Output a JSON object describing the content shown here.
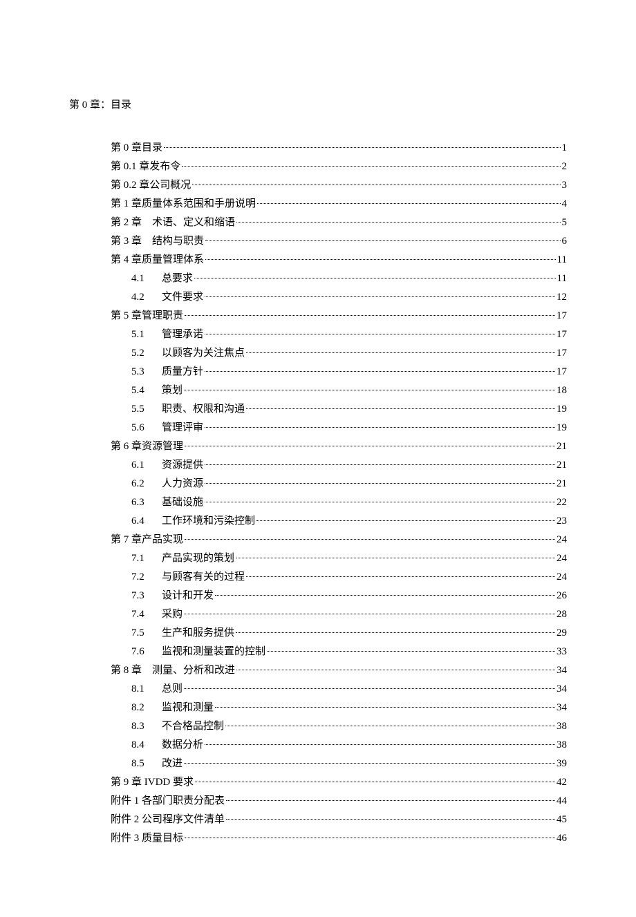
{
  "title": "第 0 章：目录",
  "toc": [
    {
      "level": 1,
      "num": "",
      "label": "第 0 章目录",
      "page": "1"
    },
    {
      "level": 1,
      "num": "",
      "label": "第 0.1 章发布令",
      "page": "2"
    },
    {
      "level": 1,
      "num": "",
      "label": "第 0.2 章公司概况",
      "page": "3"
    },
    {
      "level": 1,
      "num": "",
      "label": "第 1 章质量体系范围和手册说明",
      "page": "4"
    },
    {
      "level": 1,
      "num": "",
      "label": "第 2 章　术语、定义和缩语",
      "page": "5"
    },
    {
      "level": 1,
      "num": "",
      "label": "第 3 章　结构与职责",
      "page": "6"
    },
    {
      "level": 1,
      "num": "",
      "label": "第 4 章质量管理体系",
      "page": "11"
    },
    {
      "level": 2,
      "num": "4.1",
      "label": "总要求",
      "page": "11"
    },
    {
      "level": 2,
      "num": "4.2",
      "label": "文件要求",
      "page": "12"
    },
    {
      "level": 1,
      "num": "",
      "label": "第 5 章管理职责",
      "page": "17"
    },
    {
      "level": 2,
      "num": "5.1",
      "label": "管理承诺",
      "page": "17"
    },
    {
      "level": 2,
      "num": "5.2",
      "label": "以顾客为关注焦点",
      "page": "17"
    },
    {
      "level": 2,
      "num": "5.3",
      "label": "质量方针",
      "page": "17"
    },
    {
      "level": 2,
      "num": "5.4",
      "label": "策划",
      "page": "18"
    },
    {
      "level": 2,
      "num": "5.5",
      "label": "职责、权限和沟通",
      "page": "19"
    },
    {
      "level": 2,
      "num": "5.6",
      "label": "管理评审",
      "page": "19"
    },
    {
      "level": 1,
      "num": "",
      "label": "第 6 章资源管理",
      "page": "21"
    },
    {
      "level": 2,
      "num": "6.1",
      "label": "资源提供",
      "page": "21"
    },
    {
      "level": 2,
      "num": "6.2",
      "label": "人力资源",
      "page": "21"
    },
    {
      "level": 2,
      "num": "6.3",
      "label": "基础设施",
      "page": "22"
    },
    {
      "level": 2,
      "num": "6.4",
      "label": "工作环境和污染控制",
      "page": "23"
    },
    {
      "level": 1,
      "num": "",
      "label": "第 7 章产品实现",
      "page": "24"
    },
    {
      "level": 2,
      "num": "7.1",
      "label": "产品实现的策划",
      "page": "24"
    },
    {
      "level": 2,
      "num": "7.2",
      "label": "与顾客有关的过程",
      "page": "24"
    },
    {
      "level": 2,
      "num": "7.3",
      "label": "设计和开发",
      "page": "26"
    },
    {
      "level": 2,
      "num": "7.4",
      "label": "采购",
      "page": "28"
    },
    {
      "level": 2,
      "num": "7.5",
      "label": "生产和服务提供",
      "page": "29"
    },
    {
      "level": 2,
      "num": "7.6",
      "label": "监视和测量装置的控制",
      "page": "33"
    },
    {
      "level": 1,
      "num": "",
      "label": "第 8 章　测量、分析和改进",
      "page": "34"
    },
    {
      "level": 2,
      "num": "8.1",
      "label": "总则",
      "page": "34"
    },
    {
      "level": 2,
      "num": "8.2",
      "label": "监视和测量",
      "page": "34"
    },
    {
      "level": 2,
      "num": "8.3",
      "label": "不合格品控制",
      "page": "38"
    },
    {
      "level": 2,
      "num": "8.4",
      "label": "数据分析",
      "page": "38"
    },
    {
      "level": 2,
      "num": "8.5",
      "label": "改进",
      "page": "39"
    },
    {
      "level": 1,
      "num": "",
      "label": "第 9 章 IVDD 要求",
      "page": "42"
    },
    {
      "level": 1,
      "num": "",
      "label": "附件 1 各部门职责分配表",
      "page": "44"
    },
    {
      "level": 1,
      "num": "",
      "label": "附件 2 公司程序文件清单",
      "page": "45"
    },
    {
      "level": 1,
      "num": "",
      "label": "附件 3 质量目标",
      "page": "46"
    }
  ]
}
